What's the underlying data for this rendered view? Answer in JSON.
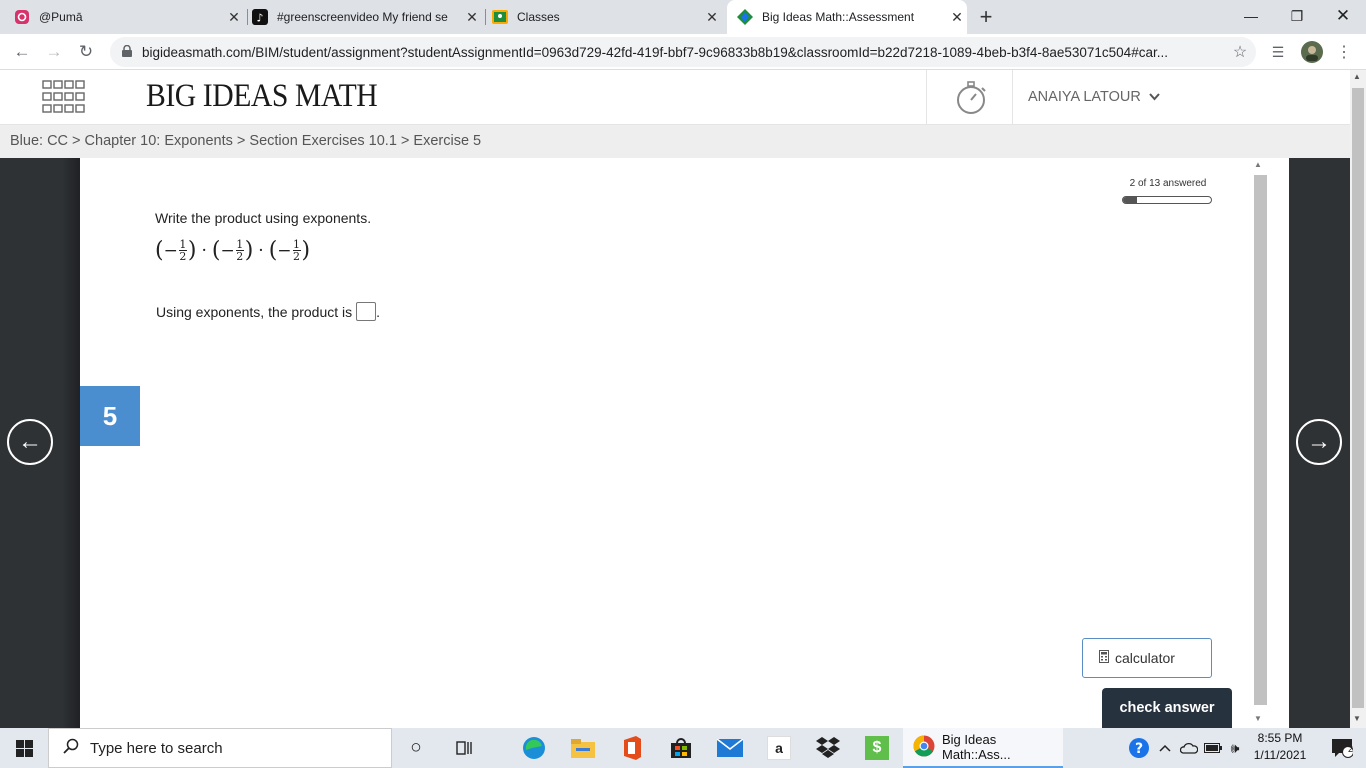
{
  "tabs": [
    {
      "title": "@Pumā",
      "close": "✕"
    },
    {
      "title": "#greenscreenvideo My friend se",
      "close": "✕"
    },
    {
      "title": "Classes",
      "close": "✕"
    },
    {
      "title": "Big Ideas Math::Assessment",
      "close": "✕"
    }
  ],
  "new_tab": "+",
  "window": {
    "minimize": "—",
    "maximize": "❐",
    "close": "✕"
  },
  "address": {
    "url": "bigideasmath.com/BIM/student/assignment?studentAssignmentId=0963d729-42fd-419f-bbf7-9c96833b8b19&classroomId=b22d7218-1089-4beb-b3f4-8ae53071c504#car..."
  },
  "header": {
    "logo": "BIG IDEAS MATH",
    "user": "ANAIYA LATOUR"
  },
  "breadcrumb": "Blue: CC > Chapter 10: Exponents > Section Exercises 10.1 > Exercise 5",
  "progress": {
    "label": "2 of 13 answered",
    "answered": 2,
    "total": 13
  },
  "question": {
    "prompt": "Write the product using exponents.",
    "factor_sign": "−",
    "numerator": "1",
    "denominator": "2",
    "dot": "·",
    "answer_prefix": "Using exponents, the product is",
    "answer_suffix": "."
  },
  "exercise_number": "5",
  "buttons": {
    "calculator": "calculator",
    "check": "check answer"
  },
  "taskbar": {
    "search_placeholder": "Type here to search",
    "chrome_window": "Big Ideas Math::Ass...",
    "amazon": "a",
    "time": "8:55 PM",
    "date": "1/11/2021",
    "notif_count": "2"
  }
}
